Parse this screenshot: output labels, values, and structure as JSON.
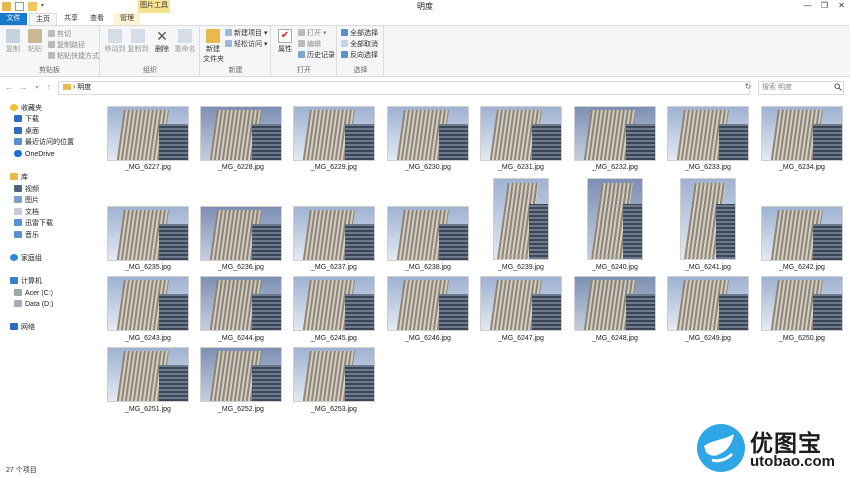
{
  "window": {
    "title": "明度",
    "minimize": "—",
    "maximize": "❐",
    "close": "✕"
  },
  "context_tab_group": "图片工具",
  "tabs": {
    "file": "文件",
    "home": "主页",
    "share": "共享",
    "view": "查看",
    "manage": "管理"
  },
  "ribbon": {
    "clipboard": {
      "label": "剪贴板",
      "copy": "复制",
      "paste": "粘贴",
      "cut": "剪切",
      "copy_path": "复制路径",
      "paste_shortcut": "粘贴快捷方式"
    },
    "organize": {
      "label": "组织",
      "move_to": "移动到",
      "copy_to": "复制到",
      "delete": "删除",
      "rename": "重命名"
    },
    "new": {
      "label": "新建",
      "new_folder": "新建\n文件夹",
      "new_item": "新建项目",
      "easy_access": "轻松访问"
    },
    "open": {
      "label": "打开",
      "properties": "属性",
      "open": "打开",
      "edit": "编辑",
      "history": "历史记录"
    },
    "select": {
      "label": "选择",
      "select_all": "全部选择",
      "select_none": "全部取消",
      "invert": "反向选择"
    }
  },
  "address": {
    "back": "←",
    "forward": "→",
    "up": "↑",
    "path_sep": "›",
    "path": "明度",
    "refresh": "↻",
    "search_placeholder": "搜索 明度"
  },
  "nav": {
    "favorites": "收藏夹",
    "downloads": "下载",
    "desktop": "桌面",
    "recent": "最近访问的位置",
    "onedrive": "OneDrive",
    "libraries": "库",
    "videos": "视频",
    "pictures": "图片",
    "documents": "文档",
    "thunder": "迅雷下载",
    "music": "音乐",
    "homegroup": "家庭组",
    "computer": "计算机",
    "acer": "Acer (C:)",
    "data": "Data (D:)",
    "network": "网络"
  },
  "files": [
    "_MG_6227.jpg",
    "_MG_6228.jpg",
    "_MG_6229.jpg",
    "_MG_6230.jpg",
    "_MG_6231.jpg",
    "_MG_6232.jpg",
    "_MG_6233.jpg",
    "_MG_6234.jpg",
    "_MG_6235.jpg",
    "_MG_6236.jpg",
    "_MG_6237.jpg",
    "_MG_6238.jpg",
    "_MG_6239.jpg",
    "_MG_6240.jpg",
    "_MG_6241.jpg",
    "_MG_6242.jpg",
    "_MG_6243.jpg",
    "_MG_6244.jpg",
    "_MG_6245.jpg",
    "_MG_6246.jpg",
    "_MG_6247.jpg",
    "_MG_6248.jpg",
    "_MG_6249.jpg",
    "_MG_6250.jpg",
    "_MG_6251.jpg",
    "_MG_6252.jpg",
    "_MG_6253.jpg"
  ],
  "status": {
    "count": "27 个项目"
  },
  "watermark": {
    "text": "优图宝",
    "url": "utobao.com"
  }
}
